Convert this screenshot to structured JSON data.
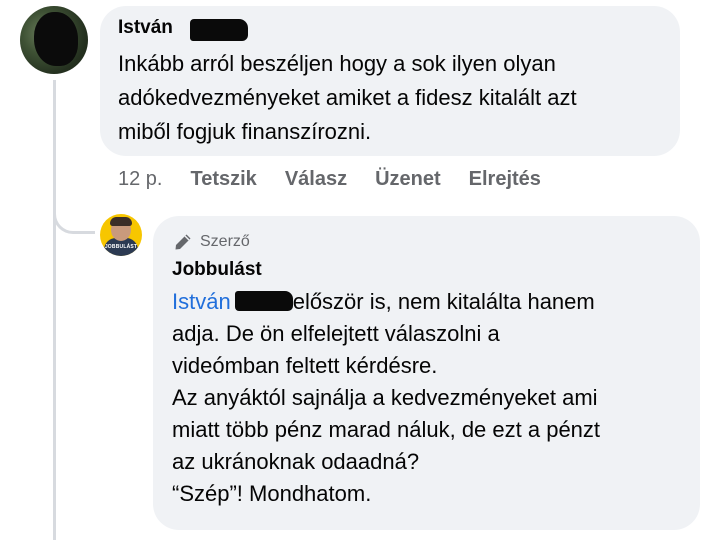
{
  "comment": {
    "author_name": "István",
    "text_lines": [
      "Inkább arról beszéljen hogy a sok ilyen olyan",
      "adókedvezményeket amiket a fidesz kitalált azt",
      "miből fogjuk finanszírozni."
    ],
    "time": "12 p.",
    "actions": [
      "Tetszik",
      "Válasz",
      "Üzenet",
      "Elrejtés"
    ]
  },
  "reply": {
    "badge": "Szerző",
    "author_name": "Jobbulást",
    "avatar_text": "JOBBULÁST",
    "mention": "István",
    "first_line_rest": "először is, nem kitalálta hanem",
    "text_lines": [
      "adja. De ön elfelejtett válaszolni a",
      "videómban feltett kérdésre.",
      "Az anyáktól sajnálja a kedvezményeket ami",
      "miatt több pénz marad náluk, de ezt a pénzt",
      "az ukránoknak odaadná?",
      "“Szép”!  Mondhatom."
    ]
  },
  "colors": {
    "bubble": "#f0f2f5",
    "mention": "#216fdb",
    "meta": "#65676b",
    "thread_line": "#d7dadf",
    "avatar_brand": "#f7c600"
  }
}
